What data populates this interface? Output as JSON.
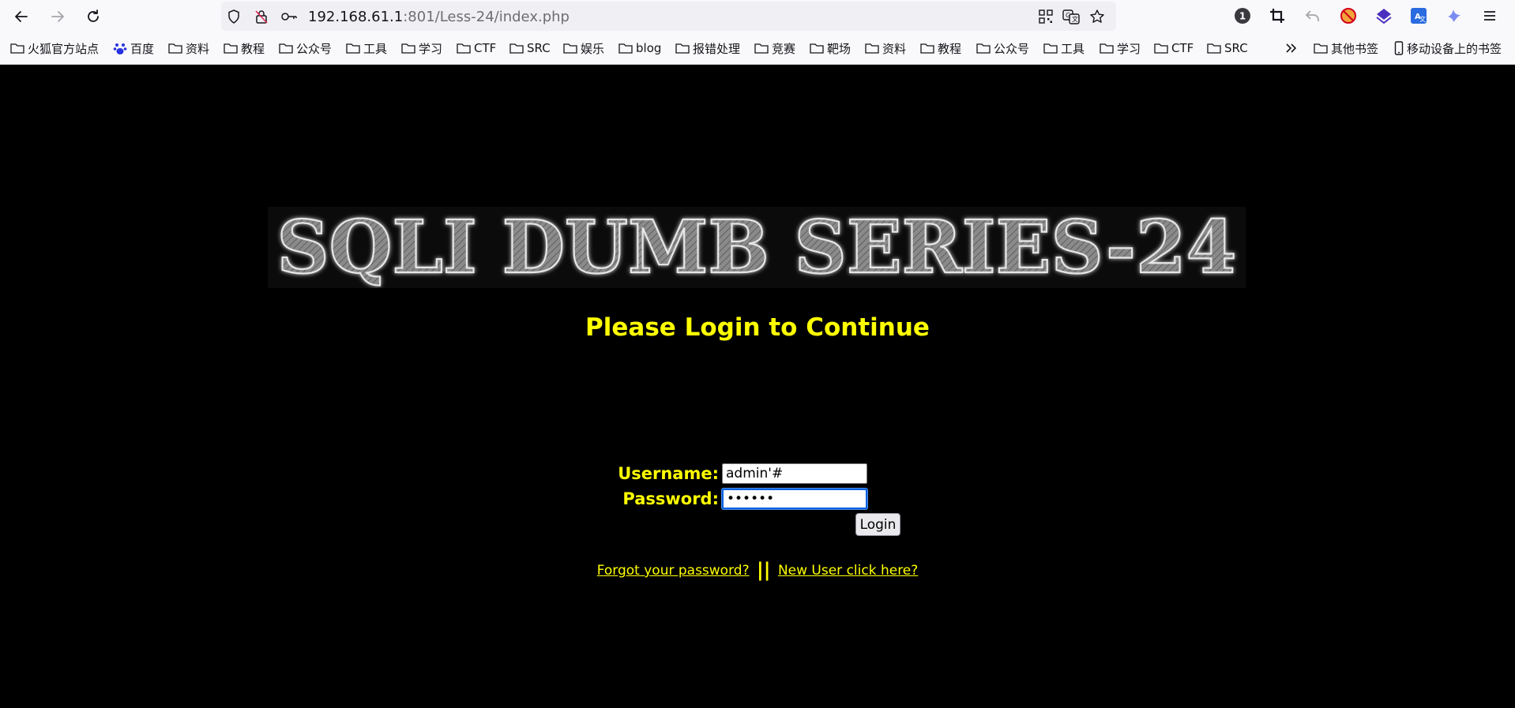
{
  "browser": {
    "url_host": "192.168.61.1",
    "url_rest": ":801/Less-24/index.php",
    "bookmarks": [
      "火狐官方站点",
      "百度",
      "资料",
      "教程",
      "公众号",
      "工具",
      "学习",
      "CTF",
      "SRC",
      "娱乐",
      "blog",
      "报错处理",
      "竞赛",
      "靶场",
      "资料",
      "教程",
      "公众号",
      "工具",
      "学习",
      "CTF",
      "SRC"
    ],
    "other_bookmarks": "其他书签",
    "mobile_bookmarks": "移动设备上的书签",
    "extension_badge": "1"
  },
  "page": {
    "banner_text": "SQLI DUMB SERIES-24",
    "heading": "Please Login to Continue",
    "username_label": "Username:",
    "password_label": "Password:",
    "username_value": "admin'#",
    "password_value": "••••••",
    "login_button": "Login",
    "forgot_link": "Forgot your password?",
    "separator": "||",
    "new_user_link": "New User click here?"
  }
}
